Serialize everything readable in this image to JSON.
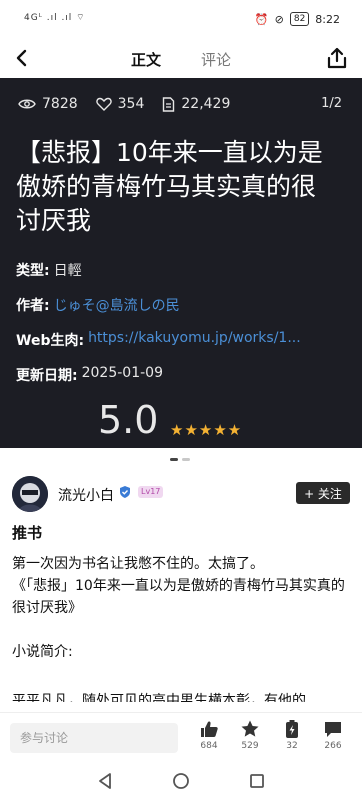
{
  "status_bar": {
    "left_text": "4Gᴸ .ıl .ıl ⌔",
    "battery": "82",
    "time": "8:22"
  },
  "nav": {
    "tabs": [
      {
        "label": "正文",
        "active": true
      },
      {
        "label": "评论",
        "active": false
      }
    ]
  },
  "hero": {
    "views": "7828",
    "likes": "354",
    "words": "22,429",
    "page_indicator": "1/2",
    "title": "【悲报】10年来一直以为是傲娇的青梅竹马其实真的很讨厌我",
    "type_key": "类型:",
    "type_val": "日輕",
    "author_key": "作者:",
    "author_val": "じゅそ@島流しの民",
    "raw_key": "Web生肉:",
    "raw_val": "https://kakuyomu.jp/works/1...",
    "date_key": "更新日期:",
    "date_val": "2025-01-09",
    "rating": "5.0",
    "stars": "★★★★★",
    "star_color": "#f4b233"
  },
  "author": {
    "name": "流光小白",
    "level": "Lv17",
    "follow": "+ 关注"
  },
  "post": {
    "heading": "推书",
    "line1": "第一次因为书名让我憋不住的。太搞了。",
    "line2": "《「悲报」10年来一直以为是傲娇的青梅竹马其实真的很讨厌我》",
    "line3": "小说简介:",
    "cut": "平平凡凡，随处可见的高中男生横本彰，有他的"
  },
  "bottom": {
    "placeholder": "参与讨论",
    "likes": "684",
    "favs": "529",
    "charge": "32",
    "comments": "266"
  }
}
